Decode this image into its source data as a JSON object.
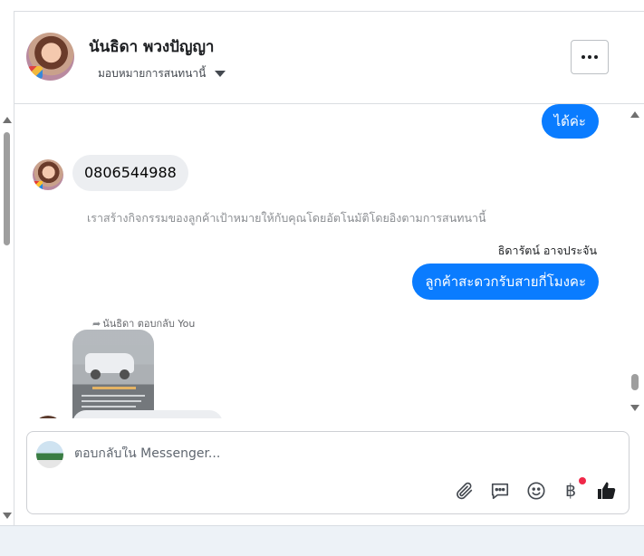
{
  "header": {
    "contact_name": "นันธิดา พวงปัญญา",
    "assign_label": "มอบหมายการสนทนานี้"
  },
  "messages": {
    "outgoing_1": "ได้ค่ะ",
    "incoming_phone": "0806544988",
    "system_note": "เราสร้างกิจกรรมของลูกค้าเป้าหมายให้กับคุณโดยอัตโนมัติโดยอิงตามการสนทนานี้",
    "sender_name": "ธิดารัตน์ อาจประจัน",
    "outgoing_2": "ลูกค้าสะดวกรับสายกี่โมงคะ",
    "reply_label": "นันธิดา ตอบกลับ You"
  },
  "composer": {
    "placeholder": "ตอบกลับใน Messenger...",
    "icons": [
      "paperclip-icon",
      "saved-reply-icon",
      "emoji-icon",
      "baht-payment-icon",
      "thumbs-up-icon"
    ],
    "baht_symbol": "฿"
  },
  "colors": {
    "accent": "#0a7cff",
    "incoming_bubble": "#eceef1",
    "badge": "#f02849"
  }
}
